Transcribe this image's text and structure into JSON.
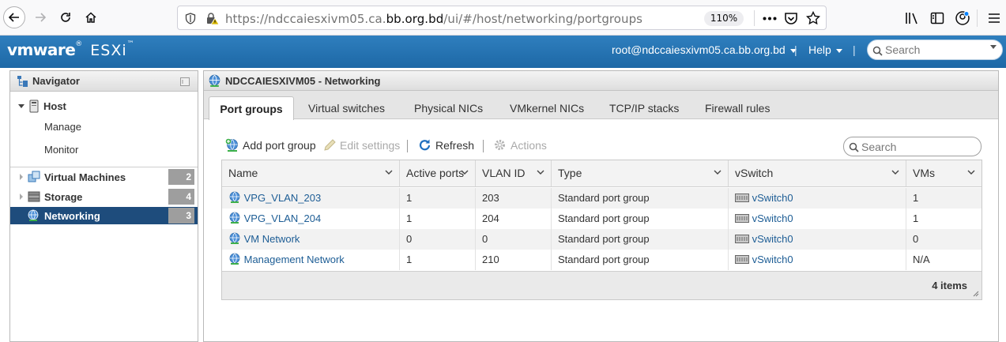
{
  "browser": {
    "url_prefix": "https://ndccaiesxivm05.ca.",
    "url_domain": "bb.org.bd",
    "url_path": "/ui/#/host/networking/portgroups",
    "zoom": "110%"
  },
  "header": {
    "logo_vm": "vmware",
    "logo_product": "ESXi",
    "user": "root@ndccaiesxivm05.ca.bb.org.bd",
    "separator": "|",
    "help": "Help",
    "search_placeholder": "Search"
  },
  "navigator": {
    "title": "Navigator",
    "host": "Host",
    "manage": "Manage",
    "monitor": "Monitor",
    "items": [
      {
        "label": "Virtual Machines",
        "count": "2"
      },
      {
        "label": "Storage",
        "count": "4"
      },
      {
        "label": "Networking",
        "count": "3"
      }
    ]
  },
  "main": {
    "title": "NDCCAIESXIVM05 - Networking",
    "tabs": [
      {
        "label": "Port groups"
      },
      {
        "label": "Virtual switches"
      },
      {
        "label": "Physical NICs"
      },
      {
        "label": "VMkernel NICs"
      },
      {
        "label": "TCP/IP stacks"
      },
      {
        "label": "Firewall rules"
      }
    ],
    "toolbar": {
      "add": "Add port group",
      "edit": "Edit settings",
      "refresh": "Refresh",
      "actions": "Actions",
      "search_placeholder": "Search"
    },
    "columns": [
      "Name",
      "Active ports",
      "VLAN ID",
      "Type",
      "vSwitch",
      "VMs"
    ],
    "rows": [
      {
        "name": "VPG_VLAN_203",
        "active": "1",
        "vlan": "203",
        "type": "Standard port group",
        "vswitch": "vSwitch0",
        "vms": "1"
      },
      {
        "name": "VPG_VLAN_204",
        "active": "1",
        "vlan": "204",
        "type": "Standard port group",
        "vswitch": "vSwitch0",
        "vms": "1"
      },
      {
        "name": "VM Network",
        "active": "0",
        "vlan": "0",
        "type": "Standard port group",
        "vswitch": "vSwitch0",
        "vms": "0"
      },
      {
        "name": "Management Network",
        "active": "1",
        "vlan": "210",
        "type": "Standard port group",
        "vswitch": "vSwitch0",
        "vms": "N/A"
      }
    ],
    "footer": "4 items"
  },
  "colors": {
    "header_blue": "#1d68a6",
    "nav_active": "#1e4c7c",
    "link": "#1d5d95"
  }
}
